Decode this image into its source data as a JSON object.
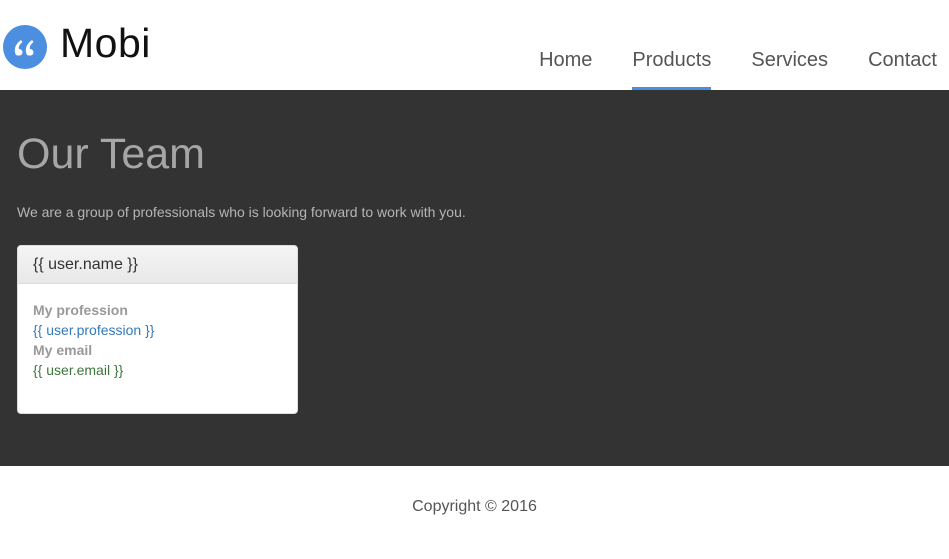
{
  "brand": {
    "name": "Mobi",
    "icon": "quote-icon",
    "icon_color": "#4c8fe0"
  },
  "nav": {
    "items": [
      {
        "label": "Home",
        "active": false
      },
      {
        "label": "Products",
        "active": true
      },
      {
        "label": "Services",
        "active": false
      },
      {
        "label": "Contact",
        "active": false
      }
    ],
    "active_underline_color": "#4a90d9"
  },
  "main": {
    "background": "#333333",
    "title": "Our Team",
    "subtitle": "We are a group of professionals who is looking forward to work with you.",
    "card": {
      "header": "{{ user.name }}",
      "profession_label": "My profession",
      "profession_value": "{{ user.profession }}",
      "email_label": "My email",
      "email_value": "{{ user.email }}"
    }
  },
  "footer": {
    "copyright": "Copyright © 2016"
  }
}
